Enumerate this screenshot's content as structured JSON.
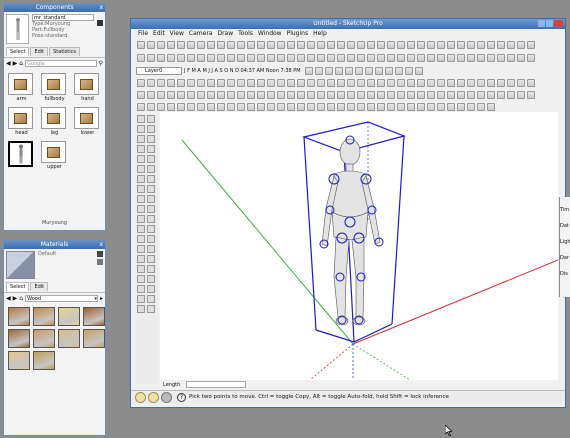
{
  "components": {
    "title": "Components",
    "close": "x",
    "selected_name": "mr_standard",
    "info_lines": [
      "Type:Muryoung",
      "Part:Fullbody",
      "Pose:standard"
    ],
    "tabs": [
      "Select",
      "Edit",
      "Statistics"
    ],
    "search_placeholder": "Google",
    "items": [
      "arm",
      "fullbody",
      "hand",
      "head",
      "leg",
      "lower",
      "",
      "upper"
    ],
    "footer": "Muryoung"
  },
  "materials": {
    "title": "Materials",
    "close": "x",
    "current": "Default",
    "tabs": [
      "Select",
      "Edit"
    ],
    "library": "Wood",
    "swatches": [
      "#b67a40",
      "#c58a4a",
      "#e7d58e",
      "#a65f2d",
      "#9d6a39",
      "#c89b67",
      "#d9bd86",
      "#c7a45f",
      "#e7c58c",
      "#c2a155"
    ]
  },
  "window": {
    "title": "Untitled - SketchUp Pro",
    "menu": [
      "File",
      "Edit",
      "View",
      "Camera",
      "Draw",
      "Tools",
      "Window",
      "Plugins",
      "Help"
    ],
    "layer": "Layer0",
    "date_text": "J F M A M J J A S O N D  04:37 AM  Noon  7:38 PM",
    "length_label": "Length",
    "status": "Pick two points to move.  Ctrl = toggle Copy, Alt = toggle Auto-fold, hold Shift = lock inference"
  },
  "right_panel": {
    "labels": [
      "Tim",
      "Dat",
      "Ligh",
      "Dar",
      "Dis"
    ]
  },
  "colors": {
    "titlebar": "#3b6eae",
    "selection_box": "#1a1acc",
    "red_axis": "#d42b2b",
    "green_axis": "#3db33d"
  }
}
